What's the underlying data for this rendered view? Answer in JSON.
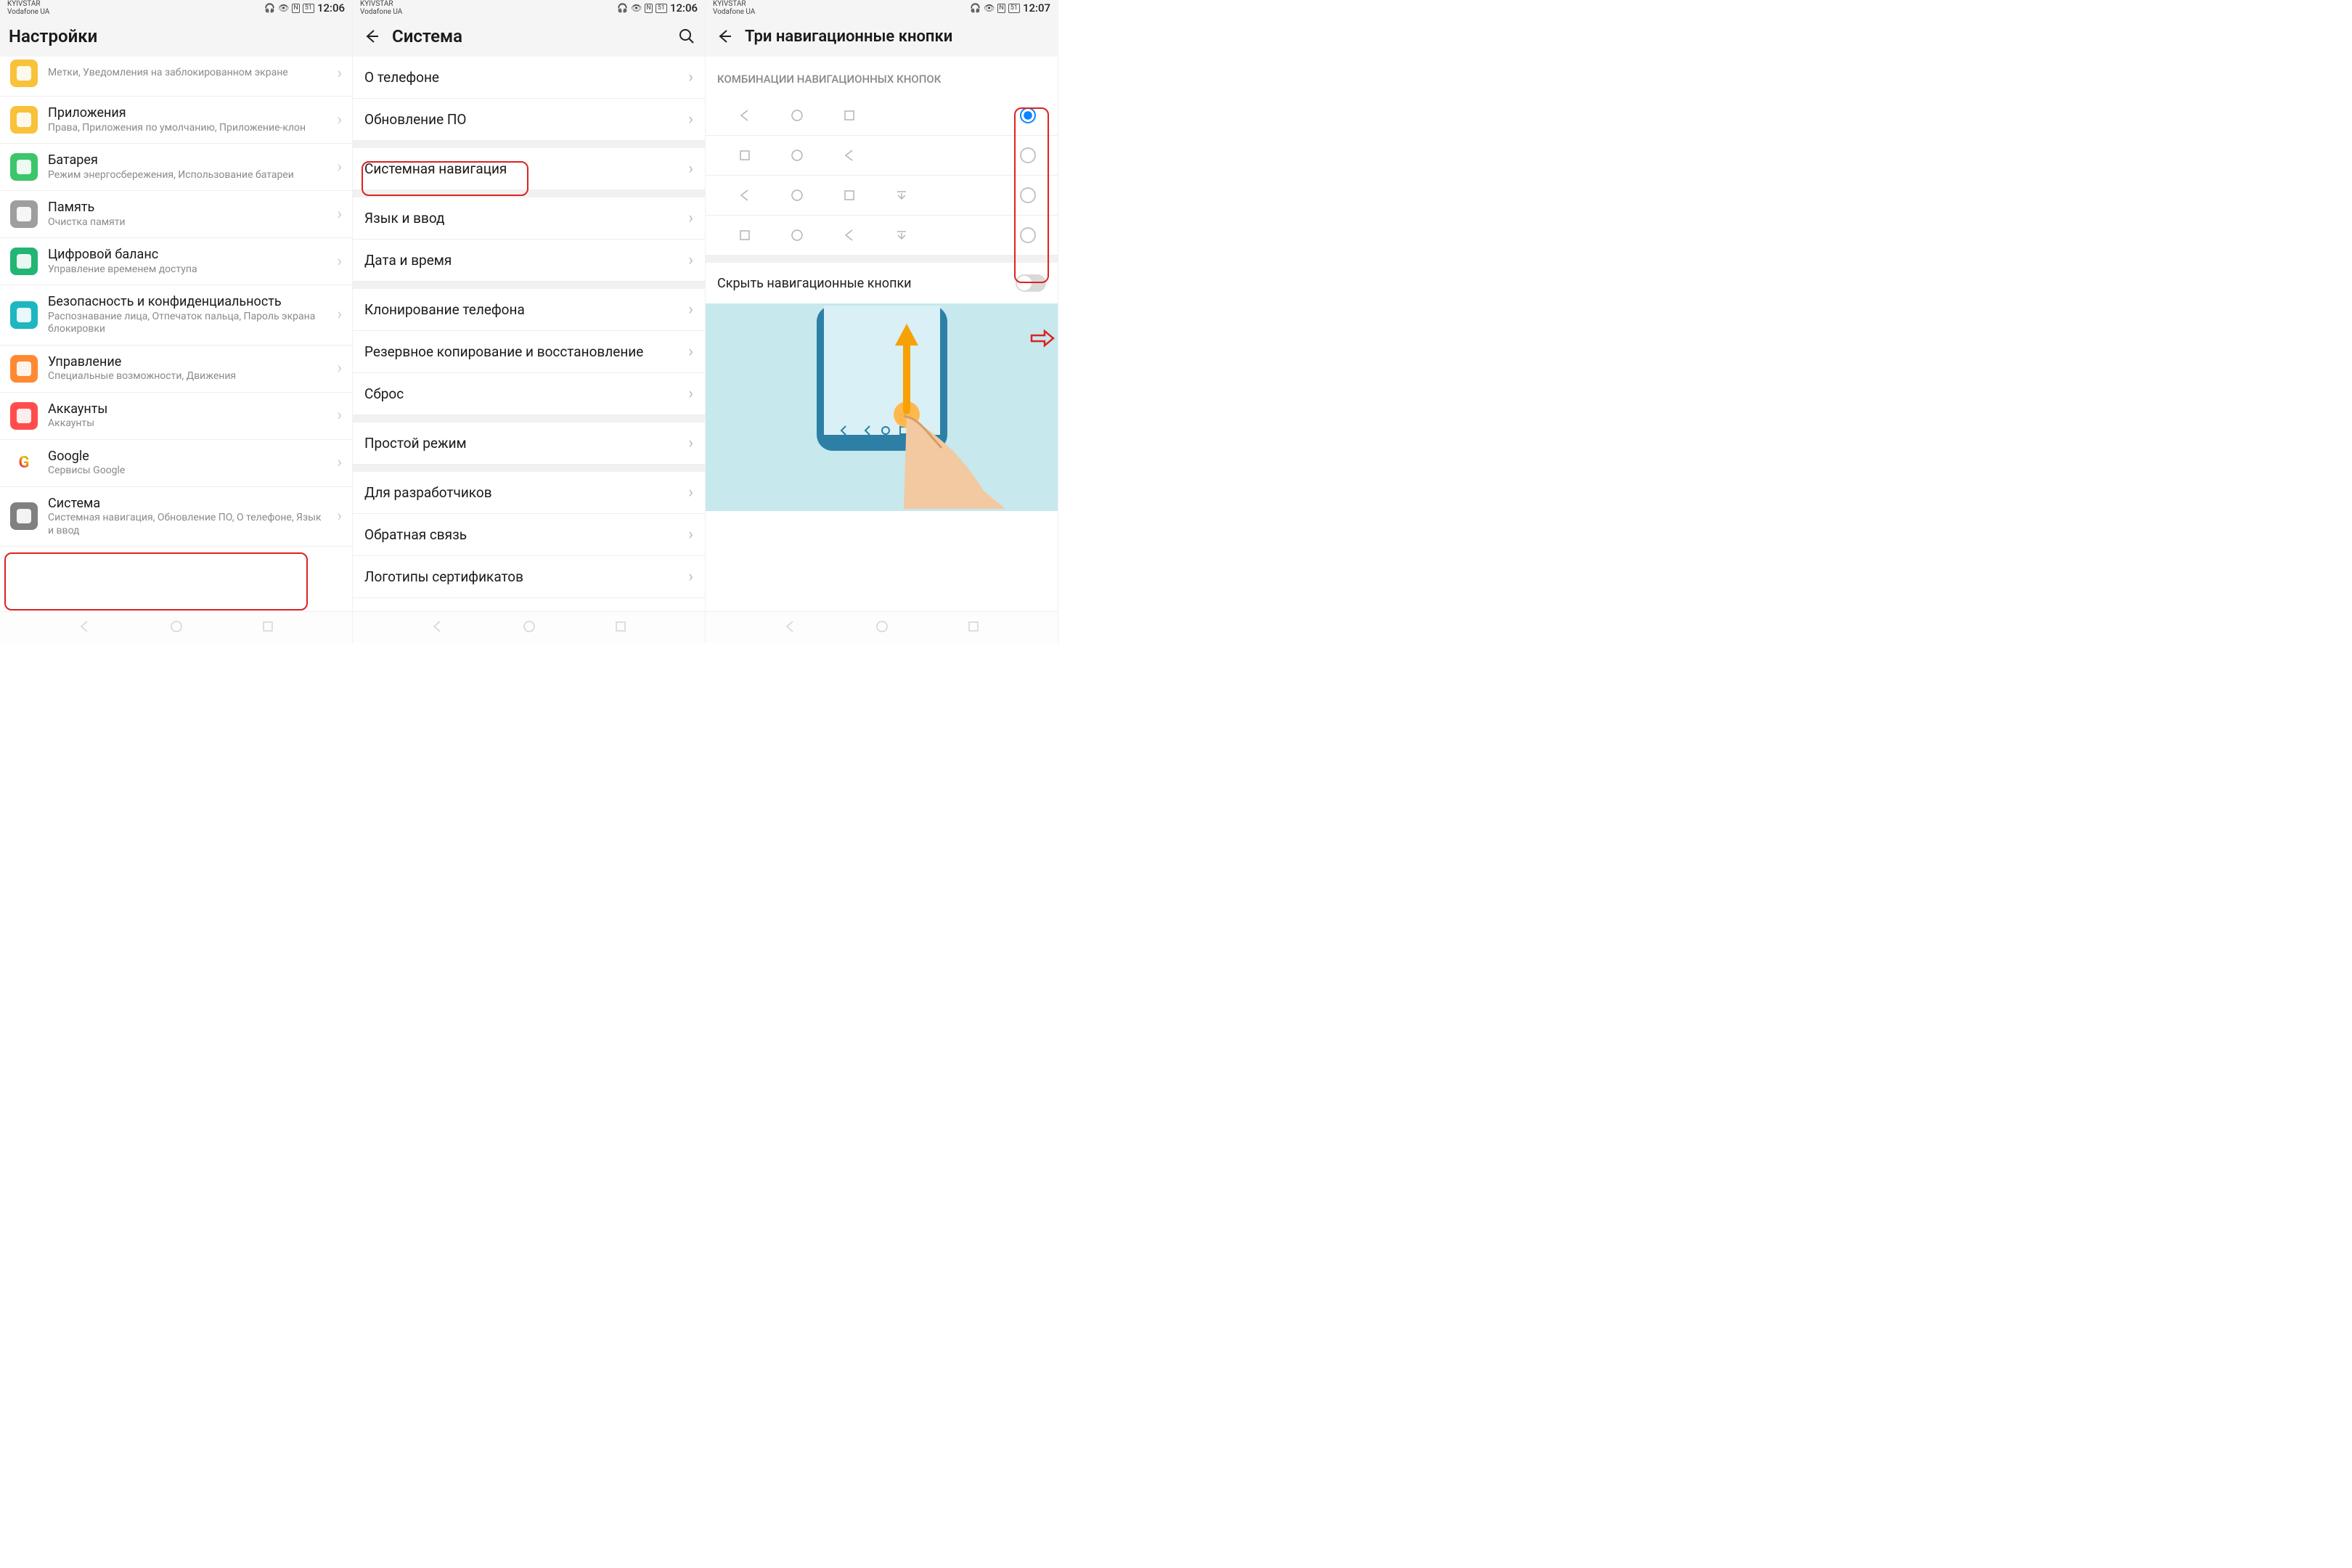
{
  "status": {
    "carrier1": "KYIVSTAR",
    "carrier2": "Vodafone UA",
    "time_a": "12:06",
    "time_b": "12:06",
    "time_c": "12:07",
    "battery": "51"
  },
  "screen1": {
    "title": "Настройки",
    "items": [
      {
        "label": "Метки, Уведомления на заблокированном экране",
        "sub": "",
        "truncated": true,
        "icon_color": "#f8c23a"
      },
      {
        "label": "Приложения",
        "sub": "Права, Приложения по умолчанию, Приложение-клон",
        "icon_color": "#f8c23a"
      },
      {
        "label": "Батарея",
        "sub": "Режим энергосбережения, Использование батареи",
        "icon_color": "#3cc66b"
      },
      {
        "label": "Память",
        "sub": "Очистка памяти",
        "icon_color": "#9e9e9e"
      },
      {
        "label": "Цифровой баланс",
        "sub": "Управление временем доступа",
        "icon_color": "#22b573"
      },
      {
        "label": "Безопасность и конфиденциальность",
        "sub": "Распознавание лица, Отпечаток пальца, Пароль экрана блокировки",
        "icon_color": "#1eb6c1"
      },
      {
        "label": "Управление",
        "sub": "Специальные возможности, Движения",
        "icon_color": "#ff8a33"
      },
      {
        "label": "Аккаунты",
        "sub": "Аккаунты",
        "icon_color": "#ff4d4d"
      },
      {
        "label": "Google",
        "sub": "Сервисы Google",
        "icon_color": "#ffffff"
      },
      {
        "label": "Система",
        "sub": "Системная навигация, Обновление ПО, О телефоне, Язык и ввод",
        "icon_color": "#808080",
        "highlighted": true
      }
    ]
  },
  "screen2": {
    "title": "Система",
    "groups": [
      [
        {
          "label": "О телефоне"
        },
        {
          "label": "Обновление ПО"
        }
      ],
      [
        {
          "label": "Системная навигация",
          "highlighted": true
        }
      ],
      [
        {
          "label": "Язык и ввод"
        },
        {
          "label": "Дата и время"
        }
      ],
      [
        {
          "label": "Клонирование телефона"
        },
        {
          "label": "Резервное копирование и восстановление"
        },
        {
          "label": "Сброс"
        }
      ],
      [
        {
          "label": "Простой режим"
        }
      ],
      [
        {
          "label": "Для разработчиков"
        },
        {
          "label": "Обратная связь"
        },
        {
          "label": "Логотипы сертификатов"
        }
      ]
    ]
  },
  "screen3": {
    "title": "Три навигационные кнопки",
    "section_title": "КОМБИНАЦИИ НАВИГАЦИОННЫХ КНОПОК",
    "combos": [
      {
        "order": [
          "back",
          "home",
          "recent"
        ],
        "extra": false,
        "selected": true
      },
      {
        "order": [
          "recent",
          "home",
          "back"
        ],
        "extra": false,
        "selected": false
      },
      {
        "order": [
          "back",
          "home",
          "recent"
        ],
        "extra": true,
        "selected": false
      },
      {
        "order": [
          "recent",
          "home",
          "back"
        ],
        "extra": true,
        "selected": false
      }
    ],
    "toggle": {
      "label": "Скрыть навигационные кнопки",
      "on": false
    }
  }
}
